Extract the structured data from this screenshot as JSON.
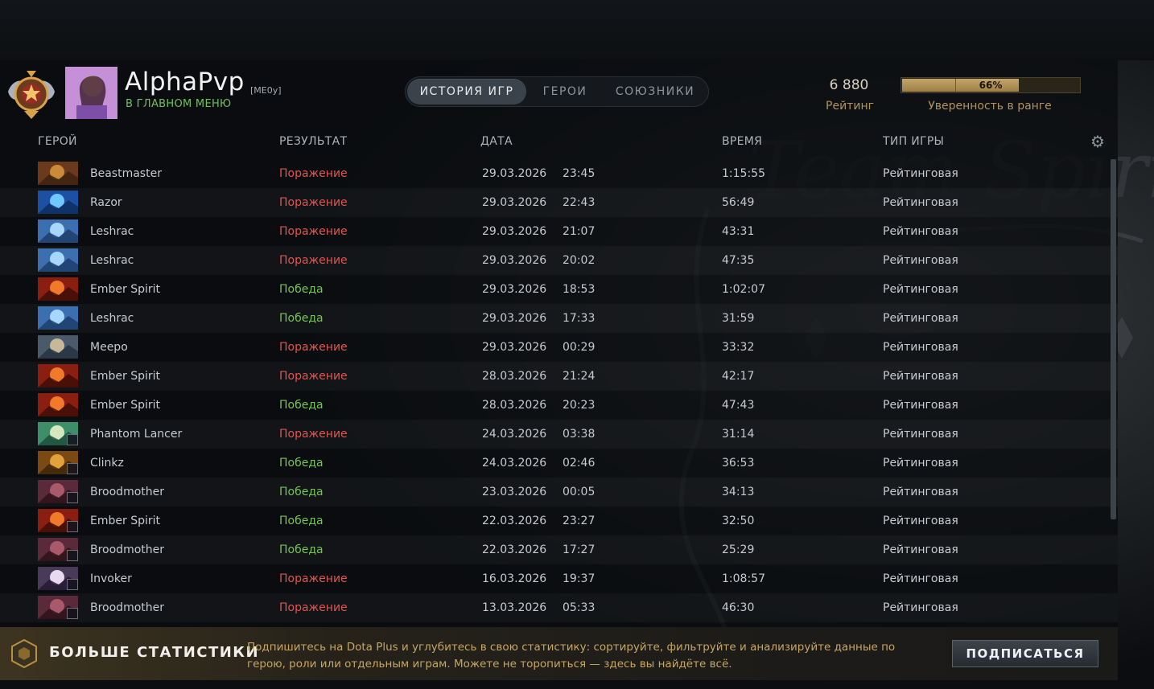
{
  "player": {
    "name": "AlphaPvp",
    "tag": "[ME0y]",
    "status": "В ГЛАВНОМ МЕНЮ"
  },
  "tabs": [
    {
      "label": "ИСТОРИЯ ИГР",
      "active": true
    },
    {
      "label": "ГЕРОИ",
      "active": false
    },
    {
      "label": "СОЮЗНИКИ",
      "active": false
    }
  ],
  "rating": {
    "value": "6 880",
    "label": "Рейтинг"
  },
  "confidence": {
    "value_text": "66%",
    "fraction": 0.66,
    "label": "Уверенность в ранге"
  },
  "columns": {
    "hero": "ГЕРОЙ",
    "result": "РЕЗУЛЬТАТ",
    "date": "ДАТА",
    "duration": "ВРЕМЯ",
    "game_type": "ТИП ИГРЫ"
  },
  "icons": {
    "settings": "gear-icon",
    "rank": "rank-medal-icon",
    "dota_plus": "dota-plus-icon"
  },
  "colors": {
    "loss": "#e4544f",
    "win": "#76c553",
    "accent_gold": "#b09363",
    "status_green": "#6fc15a"
  },
  "matches": [
    {
      "hero": "Beastmaster",
      "result": "Поражение",
      "outcome": "loss",
      "date": "29.03.2026",
      "time": "23:45",
      "duration": "1:15:55",
      "type": "Рейтинговая",
      "badge": false
    },
    {
      "hero": "Razor",
      "result": "Поражение",
      "outcome": "loss",
      "date": "29.03.2026",
      "time": "22:43",
      "duration": "56:49",
      "type": "Рейтинговая",
      "badge": false
    },
    {
      "hero": "Leshrac",
      "result": "Поражение",
      "outcome": "loss",
      "date": "29.03.2026",
      "time": "21:07",
      "duration": "43:31",
      "type": "Рейтинговая",
      "badge": false
    },
    {
      "hero": "Leshrac",
      "result": "Поражение",
      "outcome": "loss",
      "date": "29.03.2026",
      "time": "20:02",
      "duration": "47:35",
      "type": "Рейтинговая",
      "badge": false
    },
    {
      "hero": "Ember Spirit",
      "result": "Победа",
      "outcome": "win",
      "date": "29.03.2026",
      "time": "18:53",
      "duration": "1:02:07",
      "type": "Рейтинговая",
      "badge": false
    },
    {
      "hero": "Leshrac",
      "result": "Победа",
      "outcome": "win",
      "date": "29.03.2026",
      "time": "17:33",
      "duration": "31:59",
      "type": "Рейтинговая",
      "badge": false
    },
    {
      "hero": "Meepo",
      "result": "Поражение",
      "outcome": "loss",
      "date": "29.03.2026",
      "time": "00:29",
      "duration": "33:32",
      "type": "Рейтинговая",
      "badge": false
    },
    {
      "hero": "Ember Spirit",
      "result": "Поражение",
      "outcome": "loss",
      "date": "28.03.2026",
      "time": "21:24",
      "duration": "42:17",
      "type": "Рейтинговая",
      "badge": false
    },
    {
      "hero": "Ember Spirit",
      "result": "Победа",
      "outcome": "win",
      "date": "28.03.2026",
      "time": "20:23",
      "duration": "47:43",
      "type": "Рейтинговая",
      "badge": false
    },
    {
      "hero": "Phantom Lancer",
      "result": "Поражение",
      "outcome": "loss",
      "date": "24.03.2026",
      "time": "03:38",
      "duration": "31:14",
      "type": "Рейтинговая",
      "badge": true
    },
    {
      "hero": "Clinkz",
      "result": "Победа",
      "outcome": "win",
      "date": "24.03.2026",
      "time": "02:46",
      "duration": "36:53",
      "type": "Рейтинговая",
      "badge": true
    },
    {
      "hero": "Broodmother",
      "result": "Победа",
      "outcome": "win",
      "date": "23.03.2026",
      "time": "00:05",
      "duration": "34:13",
      "type": "Рейтинговая",
      "badge": true
    },
    {
      "hero": "Ember Spirit",
      "result": "Победа",
      "outcome": "win",
      "date": "22.03.2026",
      "time": "23:27",
      "duration": "32:50",
      "type": "Рейтинговая",
      "badge": true
    },
    {
      "hero": "Broodmother",
      "result": "Победа",
      "outcome": "win",
      "date": "22.03.2026",
      "time": "17:27",
      "duration": "25:29",
      "type": "Рейтинговая",
      "badge": true
    },
    {
      "hero": "Invoker",
      "result": "Поражение",
      "outcome": "loss",
      "date": "16.03.2026",
      "time": "19:37",
      "duration": "1:08:57",
      "type": "Рейтинговая",
      "badge": true
    },
    {
      "hero": "Broodmother",
      "result": "Поражение",
      "outcome": "loss",
      "date": "13.03.2026",
      "time": "05:33",
      "duration": "46:30",
      "type": "Рейтинговая",
      "badge": true
    }
  ],
  "banner": {
    "title": "БОЛЬШЕ СТАТИСТИКИ",
    "text": "Подпишитесь на Dota Plus и углубитесь в свою статистику: сортируйте, фильтруйте и анализируйте данные по герою, роли или отдельным играм. Можете не торопиться — здесь вы найдёте всё.",
    "button": "ПОДПИСАТЬСЯ"
  }
}
